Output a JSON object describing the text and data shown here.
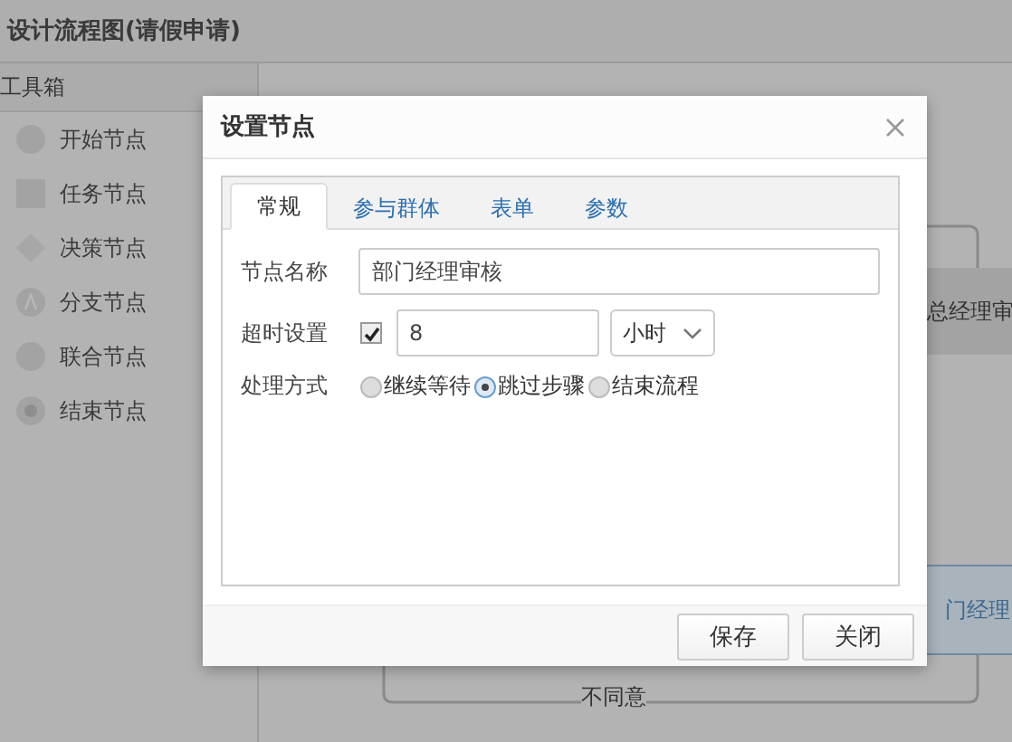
{
  "title": "设计流程图(请假申请)",
  "toolbox": {
    "title": "工具箱",
    "items": [
      {
        "label": "开始节点",
        "kind": "start"
      },
      {
        "label": "任务节点",
        "kind": "task"
      },
      {
        "label": "决策节点",
        "kind": "decision"
      },
      {
        "label": "分支节点",
        "kind": "fork"
      },
      {
        "label": "联合节点",
        "kind": "join"
      },
      {
        "label": "结束节点",
        "kind": "end"
      }
    ]
  },
  "canvas": {
    "nodes": [
      {
        "label": "总经理审",
        "selected": false
      },
      {
        "label": "门经理",
        "selected": true
      }
    ],
    "edge_label": "不同意"
  },
  "dialog": {
    "title": "设置节点",
    "tabs": [
      {
        "label": "常规",
        "selected": true
      },
      {
        "label": "参与群体",
        "selected": false
      },
      {
        "label": "表单",
        "selected": false
      },
      {
        "label": "参数",
        "selected": false
      }
    ],
    "name": {
      "label": "节点名称",
      "value": "部门经理审核"
    },
    "timeout": {
      "label": "超时设置",
      "checked": true,
      "value": "8",
      "unit": "小时"
    },
    "mode": {
      "label": "处理方式",
      "options": [
        {
          "label": "继续等待",
          "selected": false
        },
        {
          "label": "跳过步骤",
          "selected": true
        },
        {
          "label": "结束流程",
          "selected": false
        }
      ]
    },
    "buttons": [
      "保存",
      "关闭"
    ]
  }
}
